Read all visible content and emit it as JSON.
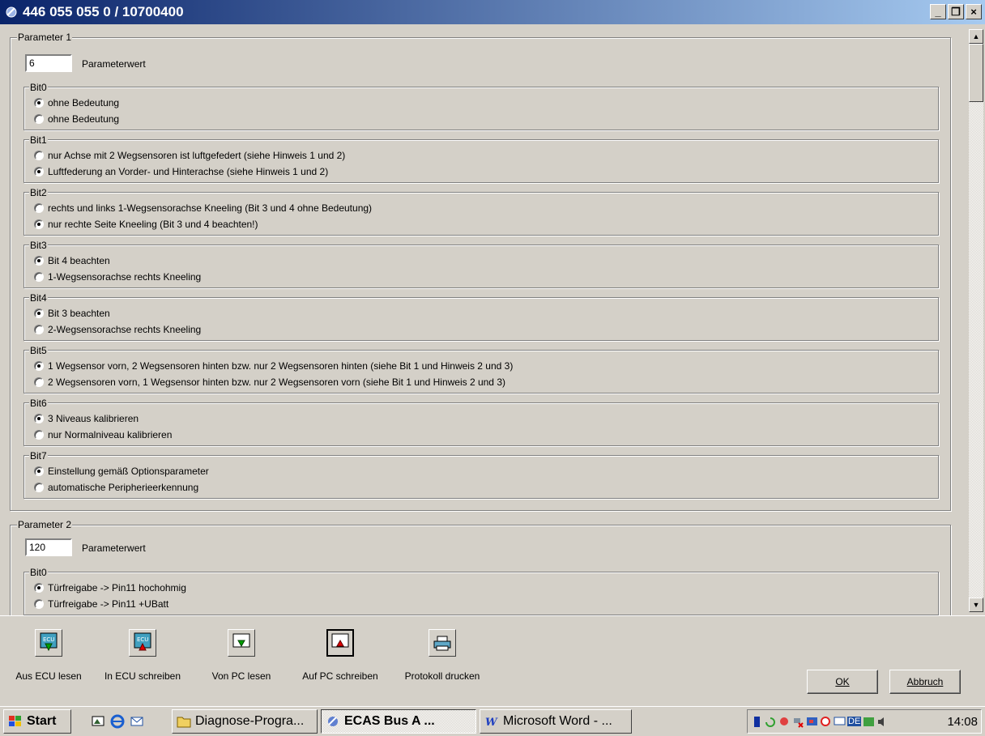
{
  "window": {
    "title": "446 055 055 0 / 10700400"
  },
  "parameter1": {
    "title": "Parameter 1",
    "value": "6",
    "value_label": "Parameterwert",
    "bits": [
      {
        "name": "Bit0",
        "options": [
          "ohne Bedeutung",
          "ohne Bedeutung"
        ],
        "selected": 0
      },
      {
        "name": "Bit1",
        "options": [
          "nur Achse mit 2 Wegsensoren ist luftgefedert   (siehe Hinweis 1 und 2)",
          "Luftfederung an Vorder- und Hinterachse   (siehe Hinweis 1 und 2)"
        ],
        "selected": 1
      },
      {
        "name": "Bit2",
        "options": [
          "rechts und links 1-Wegsensorachse Kneeling (Bit 3 und 4 ohne Bedeutung)",
          "nur rechte Seite Kneeling (Bit 3 und 4 beachten!)"
        ],
        "selected": 1
      },
      {
        "name": "Bit3",
        "options": [
          "Bit 4 beachten",
          "1-Wegsensorachse rechts Kneeling"
        ],
        "selected": 0
      },
      {
        "name": "Bit4",
        "options": [
          "Bit 3 beachten",
          "2-Wegsensorachse rechts Kneeling"
        ],
        "selected": 0
      },
      {
        "name": "Bit5",
        "options": [
          "1 Wegsensor vorn, 2 Wegsensoren hinten bzw. nur 2 Wegsensoren hinten  (siehe Bit 1 und Hinweis 2 und 3)",
          "2 Wegsensoren vorn, 1 Wegsensor hinten bzw. nur 2 Wegsensoren vorn  (siehe Bit 1 und Hinweis 2 und 3)"
        ],
        "selected": 0
      },
      {
        "name": "Bit6",
        "options": [
          "3 Niveaus kalibrieren",
          "nur Normalniveau kalibrieren"
        ],
        "selected": 0
      },
      {
        "name": "Bit7",
        "options": [
          "Einstellung gemäß Optionsparameter",
          "automatische Peripherieerkennung"
        ],
        "selected": 0
      }
    ]
  },
  "parameter2": {
    "title": "Parameter 2",
    "value": "120",
    "value_label": "Parameterwert",
    "bits": [
      {
        "name": "Bit0",
        "options": [
          "Türfreigabe -> Pin11 hochohmig",
          "Türfreigabe -> Pin11 +UBatt"
        ],
        "selected": 0
      }
    ]
  },
  "toolbar": {
    "tools": [
      {
        "label": "Aus ECU lesen",
        "icon": "ecu-read-icon"
      },
      {
        "label": "In ECU schreiben",
        "icon": "ecu-write-icon"
      },
      {
        "label": "Von PC lesen",
        "icon": "pc-read-icon"
      },
      {
        "label": "Auf PC schreiben",
        "icon": "pc-write-icon"
      },
      {
        "label": "Protokoll drucken",
        "icon": "printer-icon"
      }
    ],
    "ok": "OK",
    "cancel": "Abbruch"
  },
  "taskbar": {
    "start": "Start",
    "tasks": [
      "Diagnose-Progra...",
      "ECAS Bus A ...",
      "Microsoft Word - ..."
    ],
    "clock": "14:08",
    "tray_lang": "DE"
  },
  "colors": {
    "title_start": "#0a246a",
    "title_end": "#a6caf0",
    "face": "#d4d0c8"
  }
}
